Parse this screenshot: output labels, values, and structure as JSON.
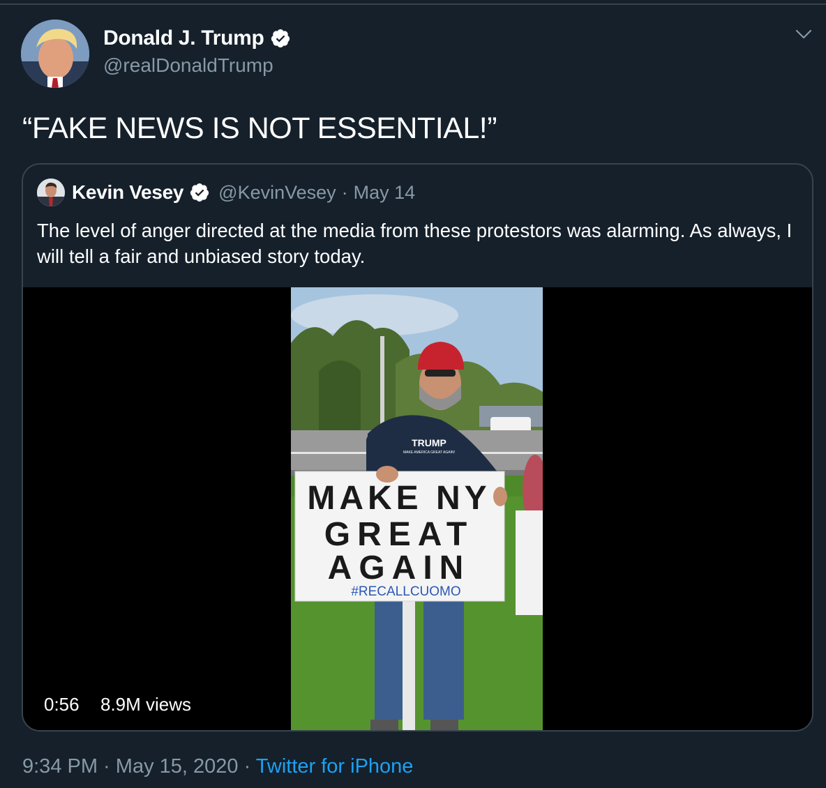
{
  "author": {
    "display_name": "Donald J. Trump",
    "handle": "@realDonaldTrump"
  },
  "tweet": {
    "text": "“FAKE NEWS IS NOT ESSENTIAL!”"
  },
  "quoted": {
    "display_name": "Kevin Vesey",
    "handle": "@KevinVesey",
    "separator": "·",
    "date": "May 14",
    "text": "The level of anger directed at the media from these protestors was alarming. As always, I will tell a fair and unbiased story today.",
    "video": {
      "duration": "0:56",
      "views": "8.9M views",
      "shirt_text": "TRUMP",
      "shirt_subtext": "MAKE AMERICA GREAT AGAIN!",
      "sign_line1": "MAKE NY",
      "sign_line2": "GREAT",
      "sign_line3": "AGAIN",
      "sign_hashtag": "#RECALLCUOMO"
    }
  },
  "meta": {
    "time": "9:34 PM",
    "sep1": " · ",
    "date": "May 15, 2020",
    "sep2": " · ",
    "source": "Twitter for iPhone"
  },
  "colors": {
    "background": "#15202b",
    "border": "#38444d",
    "secondary_text": "#8899a6",
    "link": "#1da1f2",
    "verified": "#ffffff"
  },
  "icons": {
    "verified": "verified-badge-icon",
    "caret": "chevron-down-icon"
  }
}
